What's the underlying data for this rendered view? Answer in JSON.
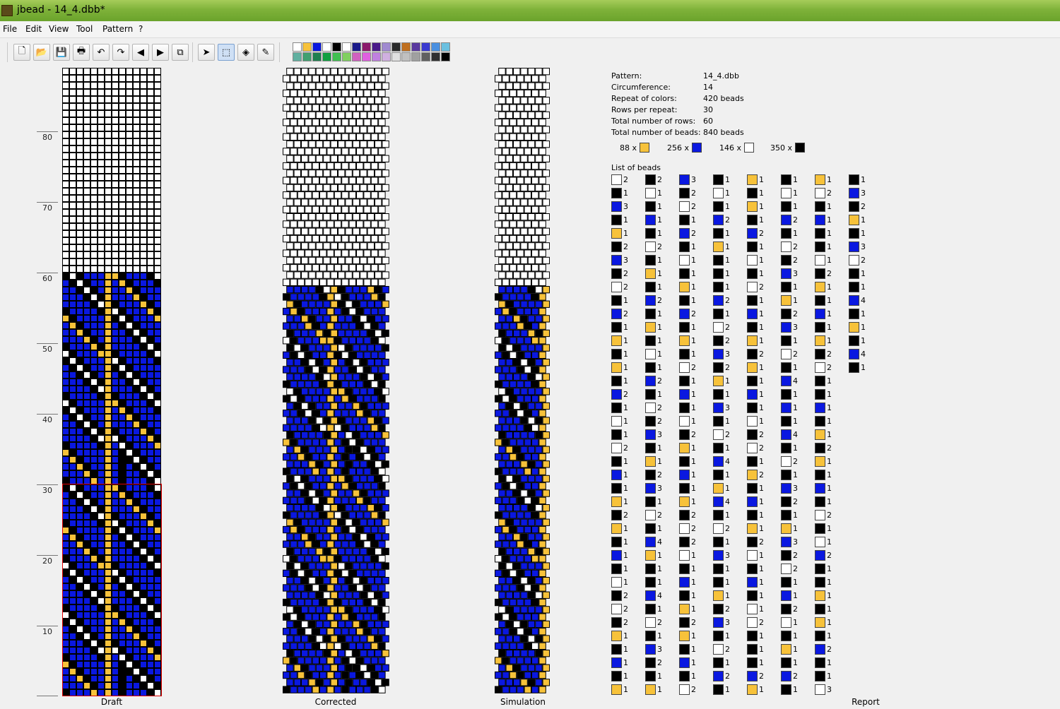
{
  "window": {
    "title": "jbead - 14_4.dbb*"
  },
  "menu": [
    {
      "label": "File",
      "underline": "F"
    },
    {
      "label": "Edit",
      "underline": "E"
    },
    {
      "label": "View",
      "underline": "V"
    },
    {
      "label": "Tool",
      "underline": "T"
    },
    {
      "label": "Pattern",
      "underline": "P"
    },
    {
      "label": "?",
      "underline": "?"
    }
  ],
  "toolbar": [
    {
      "name": "new-icon",
      "glyph": "🗋"
    },
    {
      "name": "open-icon",
      "glyph": "📂"
    },
    {
      "name": "save-icon",
      "glyph": "💾"
    },
    {
      "name": "print-icon",
      "glyph": "🖶"
    },
    {
      "name": "undo-icon",
      "glyph": "↶"
    },
    {
      "name": "redo-icon",
      "glyph": "↷"
    },
    {
      "name": "arrow-left-icon",
      "glyph": "◀"
    },
    {
      "name": "arrow-right-icon",
      "glyph": "▶"
    },
    {
      "name": "copy-icon",
      "glyph": "⧉"
    },
    {
      "name": "pointer-icon",
      "glyph": "➤"
    },
    {
      "name": "select-icon",
      "glyph": "⬚"
    },
    {
      "name": "fill-icon",
      "glyph": "◈"
    },
    {
      "name": "pipette-icon",
      "glyph": "✎"
    }
  ],
  "colors": {
    "yellow": "#f7c23a",
    "blue": "#0a18e0",
    "white": "#ffffff",
    "black": "#000000",
    "accent": "#7fb23a"
  },
  "palette": {
    "row1": [
      "#ffffff",
      "#f7c23a",
      "#0a18e0",
      "#ffffff",
      "#000000",
      "#ffffff",
      "#1a1a8a",
      "#8b1a6b",
      "#4a1a8a",
      "#a08ad0",
      "#2a2a2a",
      "#c07020",
      "#5a3aa0",
      "#3a3ad0",
      "#4a90e0",
      "#6ac0e0"
    ],
    "row2": [
      "#60b0a0",
      "#40a070",
      "#208050",
      "#10a040",
      "#40c050",
      "#80d060",
      "#d060c0",
      "#e060e0",
      "#c080e0",
      "#d0b0e0",
      "#e0e0e0",
      "#c0c0c0",
      "#a0a0a0",
      "#606060",
      "#303030",
      "#000000"
    ]
  },
  "ruler": {
    "labels": [
      "80",
      "70",
      "60",
      "50",
      "40",
      "30",
      "20",
      "10"
    ]
  },
  "panels": {
    "draft": "Draft",
    "corrected": "Corrected",
    "simulation": "Simulation",
    "report": "Report"
  },
  "report": {
    "pattern_label": "Pattern:",
    "pattern_value": "14_4.dbb",
    "circumference_label": "Circumference:",
    "circumference_value": "14",
    "repeat_label": "Repeat of colors:",
    "repeat_value": "420 beads",
    "rows_per_repeat_label": "Rows per repeat:",
    "rows_per_repeat_value": "30",
    "total_rows_label": "Total number of rows:",
    "total_rows_value": "60",
    "total_beads_label": "Total number of beads:",
    "total_beads_value": "840 beads",
    "counts": [
      {
        "text": "88 x",
        "color": "yellow"
      },
      {
        "text": "256 x",
        "color": "blue"
      },
      {
        "text": "146 x",
        "color": "white"
      },
      {
        "text": "350 x",
        "color": "black"
      }
    ],
    "list_title": "List of beads",
    "bead_columns": [
      [
        "w2",
        "k1",
        "b3",
        "k1",
        "y1",
        "k2",
        "b3",
        "k2",
        "w2",
        "k1",
        "b2",
        "k1",
        "y1",
        "k1",
        "y1",
        "k1",
        "b2",
        "k1",
        "w1",
        "k1",
        "w2",
        "k1",
        "b1",
        "k1",
        "y1",
        "k2",
        "y1",
        "k1",
        "b1",
        "k1",
        "w1",
        "k2",
        "w2",
        "k2",
        "y1",
        "k1",
        "b1",
        "k1",
        "y1"
      ],
      [
        "k2",
        "w1",
        "k1",
        "b1",
        "k1",
        "w2",
        "k1",
        "y1",
        "k1",
        "b2",
        "k1",
        "y1",
        "k1",
        "w1",
        "k1",
        "b2",
        "k1",
        "w2",
        "k2",
        "b3",
        "k1",
        "y1",
        "k2",
        "b3",
        "k1",
        "w2",
        "k1",
        "b4",
        "y1",
        "k1",
        "k1",
        "b4",
        "k1",
        "w2",
        "k1",
        "b3",
        "k2",
        "k1",
        "y1"
      ],
      [
        "b3",
        "k2",
        "w2",
        "k1",
        "b2",
        "k1",
        "w1",
        "k1",
        "y1",
        "k1",
        "b2",
        "k1",
        "y1",
        "k1",
        "w2",
        "k1",
        "b1",
        "k1",
        "w1",
        "k2",
        "y1",
        "k1",
        "b1",
        "k1",
        "y1",
        "k2",
        "w2",
        "k2",
        "w1",
        "k1",
        "b1",
        "k1",
        "y1",
        "k2",
        "y1",
        "k1",
        "b1",
        "k1",
        "w2"
      ],
      [
        "k1",
        "w1",
        "k1",
        "b2",
        "k1",
        "y1",
        "k1",
        "k1",
        "k1",
        "b2",
        "k1",
        "w2",
        "k2",
        "b3",
        "k2",
        "y1",
        "k1",
        "b3",
        "k1",
        "w2",
        "k1",
        "b4",
        "k1",
        "y1",
        "b4",
        "k1",
        "w2",
        "k1",
        "b3",
        "k1",
        "k1",
        "y1",
        "k2",
        "b3",
        "k1",
        "w2",
        "k1",
        "b2",
        "k1"
      ],
      [
        "y1",
        "k1",
        "y1",
        "k1",
        "b2",
        "k1",
        "w1",
        "k1",
        "w2",
        "k1",
        "b1",
        "k1",
        "y1",
        "k2",
        "y1",
        "k1",
        "b1",
        "k1",
        "w1",
        "k2",
        "w2",
        "k1",
        "y2",
        "k1",
        "b1",
        "k1",
        "y1",
        "k2",
        "w1",
        "k1",
        "b1",
        "k1",
        "w1",
        "w2",
        "k1",
        "k1",
        "k1",
        "b2",
        "y1"
      ],
      [
        "k1",
        "w1",
        "k1",
        "b2",
        "k1",
        "w2",
        "k2",
        "b3",
        "k1",
        "y1",
        "k2",
        "b3",
        "k1",
        "w2",
        "k1",
        "b4",
        "k1",
        "b1",
        "k1",
        "b4",
        "k1",
        "w2",
        "k1",
        "b3",
        "k2",
        "k1",
        "y1",
        "b3",
        "k2",
        "w2",
        "k1",
        "b1",
        "k2",
        "w1",
        "k1",
        "y1",
        "k1",
        "b2",
        "k1"
      ],
      [
        "y1",
        "w2",
        "k1",
        "b1",
        "k1",
        "k1",
        "w1",
        "k2",
        "y1",
        "k1",
        "b1",
        "k1",
        "y1",
        "k2",
        "w2",
        "k1",
        "k1",
        "b1",
        "k1",
        "y1",
        "k2",
        "y1",
        "k1",
        "b1",
        "k1",
        "w2",
        "k1",
        "w1",
        "b2",
        "k1",
        "k1",
        "y1",
        "k1",
        "y1",
        "k1",
        "b2",
        "k1",
        "k1",
        "w3"
      ],
      [
        "k1",
        "b3",
        "k2",
        "y1",
        "k1",
        "b3",
        "w2",
        "k1",
        "k1",
        "b4",
        "k1",
        "y1",
        "k1",
        "b4",
        "k1"
      ]
    ]
  },
  "pattern": {
    "circumference": 14,
    "shift": 4,
    "rows": [
      "KBBBYBYBKBBBKW",
      "BBBYKBYBKBBKWK",
      "BBYKBBYBKBKWKB",
      "BYKBBBYBKKWKBB",
      "YKBBBBYBKWKBBB",
      "KBBBBKYBWKBBBY",
      "BBBBKWYWKBBBYK",
      "BBBKWKYKBBBYKB",
      "BBKWKBYBBBYKBB",
      "BKWKBBYBBYKBBB",
      "KWKBBBYBYKBBBK",
      "WKBBBBYYKBBBKW",
      "KBBBBKYKBBBKWK",
      "BBBBKWYBBBKWKB",
      "BBBKWKYBBKWKBB",
      "BBKWKBYBKWKBBB",
      "BKWKBBYKWKBBBB",
      "KWKBBBYWKBBBBK",
      "WKBBBYYKBBBBKW",
      "KBBBYKYBBBBKWK",
      "BBBYKBYBBBKWKB",
      "BBYKBBYBBKWKBB",
      "BYKBBBYBKWKBBB",
      "YKBBBBYKWKBBBY",
      "KBBBBKYWKBBBYK",
      "BBBBKWYKBBBYKB",
      "BBBKWKYBBBYKBB",
      "BBKWKBYBBYKBBB",
      "BKWKBBYBYKBBBK",
      "KWKBBBYYKBBBKW"
    ]
  }
}
